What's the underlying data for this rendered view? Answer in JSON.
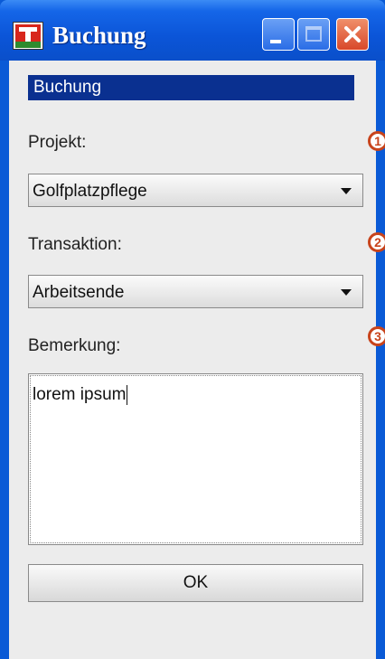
{
  "window": {
    "title": "Buchung"
  },
  "header": {
    "label": "Buchung"
  },
  "form": {
    "projekt_label": "Projekt:",
    "projekt_value": "Golfplatzpflege",
    "transaktion_label": "Transaktion:",
    "transaktion_value": "Arbeitsende",
    "bemerkung_label": "Bemerkung:",
    "bemerkung_value": "lorem ipsum",
    "ok_label": "OK"
  },
  "markers": [
    "1",
    "2",
    "3"
  ],
  "colors": {
    "titlebar": "#0b55d8",
    "header_bar": "#0a3090",
    "marker": "#c8441c",
    "close_button": "#d8482a"
  }
}
